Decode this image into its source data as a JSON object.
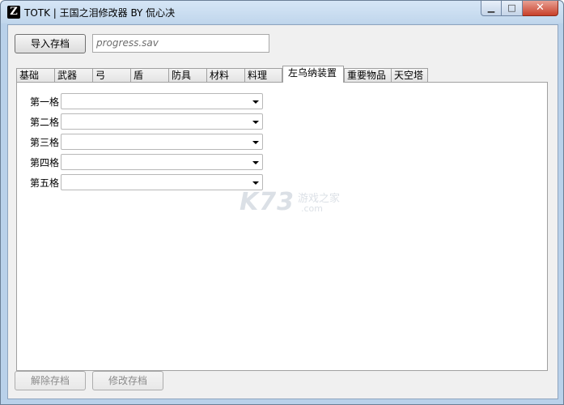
{
  "window": {
    "app_icon_letter": "Z",
    "title": "TOTK | 王国之泪修改器 BY 侃心决",
    "minimize_glyph": "▁",
    "maximize_glyph": "□",
    "close_glyph": "✕"
  },
  "toolbar": {
    "import_label": "导入存档",
    "file_path_value": "progress.sav"
  },
  "tabs": [
    {
      "label": "基础",
      "active": false
    },
    {
      "label": "武器",
      "active": false
    },
    {
      "label": "弓",
      "active": false
    },
    {
      "label": "盾",
      "active": false
    },
    {
      "label": "防具",
      "active": false
    },
    {
      "label": "材料",
      "active": false
    },
    {
      "label": "料理",
      "active": false
    },
    {
      "label": "左乌纳装置",
      "active": true
    },
    {
      "label": "重要物品",
      "active": false
    },
    {
      "label": "天空塔",
      "active": false
    }
  ],
  "slots": [
    {
      "label": "第一格",
      "value": ""
    },
    {
      "label": "第二格",
      "value": ""
    },
    {
      "label": "第三格",
      "value": ""
    },
    {
      "label": "第四格",
      "value": ""
    },
    {
      "label": "第五格",
      "value": ""
    }
  ],
  "footer": {
    "unpack_label": "解除存档",
    "modify_label": "修改存档"
  },
  "watermark": {
    "logo": "K73",
    "cn": "游戏之家",
    "com": ".com"
  }
}
